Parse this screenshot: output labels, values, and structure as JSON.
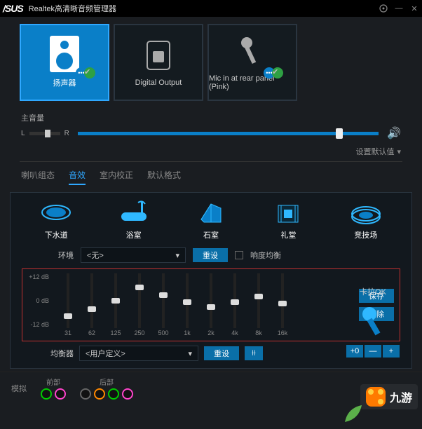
{
  "titlebar": {
    "logo": "/SUS",
    "title": "Realtek高清晰音频管理器"
  },
  "devices": [
    {
      "label": "扬声器",
      "active": true,
      "ok": true
    },
    {
      "label": "Digital Output",
      "active": false,
      "ok": false
    },
    {
      "label": "Mic in at rear panel (Pink)",
      "active": false,
      "ok": true
    }
  ],
  "volume": {
    "title": "主音量",
    "l": "L",
    "r": "R",
    "level": 88
  },
  "defaults": {
    "label": "设置默认值"
  },
  "tabs": [
    {
      "label": "喇叭组态",
      "active": false
    },
    {
      "label": "音效",
      "active": true
    },
    {
      "label": "室内校正",
      "active": false
    },
    {
      "label": "默认格式",
      "active": false
    }
  ],
  "presets": [
    {
      "label": "下水道"
    },
    {
      "label": "浴室"
    },
    {
      "label": "石室"
    },
    {
      "label": "礼堂"
    },
    {
      "label": "竞技场"
    }
  ],
  "env": {
    "label": "环境",
    "value": "<无>",
    "reset": "重设",
    "loudness": "响度均衡"
  },
  "eq": {
    "scale_top": "+12 dB",
    "scale_mid": "0 dB",
    "scale_bot": "-12 dB",
    "freqs": [
      "31",
      "62",
      "125",
      "250",
      "500",
      "1k",
      "2k",
      "4k",
      "8k",
      "16k"
    ],
    "values": [
      22,
      35,
      50,
      75,
      60,
      48,
      38,
      48,
      58,
      45
    ],
    "save": "保存",
    "delete": "删除"
  },
  "eq2": {
    "label": "均衡器",
    "value": "<用户定义>",
    "reset": "重设"
  },
  "karaoke": {
    "title": "卡拉OK",
    "zero": "+0",
    "minus": "—",
    "plus": "+"
  },
  "footer": {
    "sim": "模拟",
    "front": {
      "label": "前部"
    },
    "rear": {
      "label": "后部"
    }
  },
  "watermark": {
    "text": "九游"
  }
}
